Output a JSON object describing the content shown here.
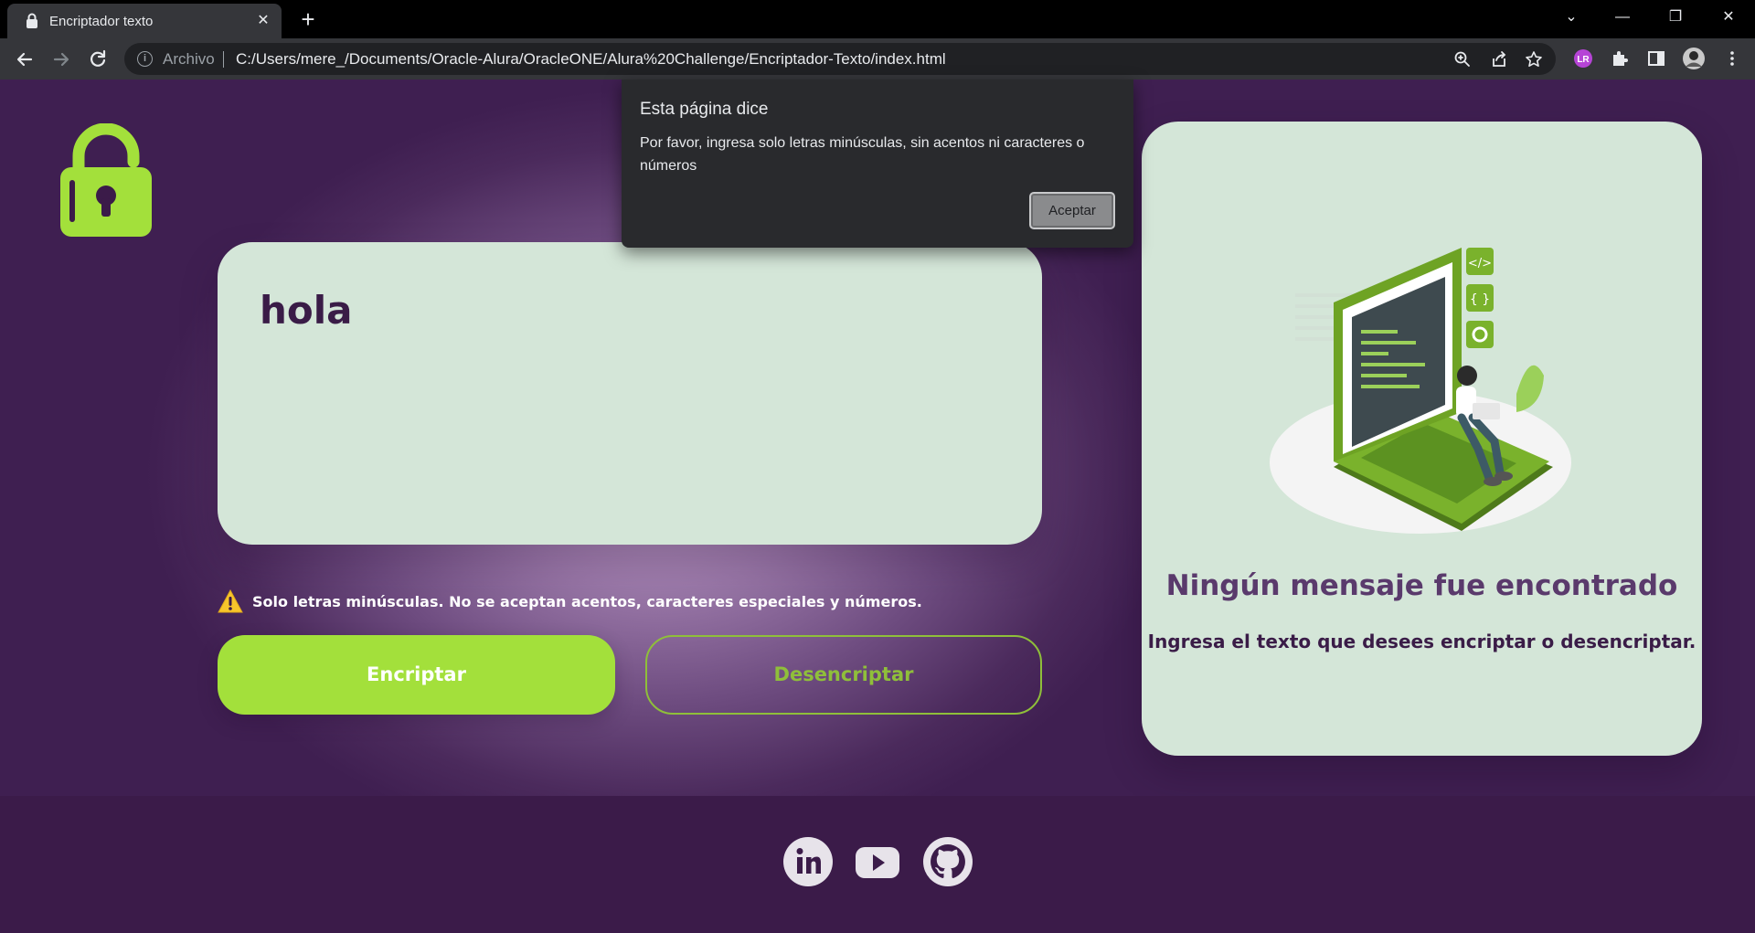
{
  "browser": {
    "tab_title": "Encriptador texto",
    "tab_close": "✕",
    "new_tab": "+",
    "url_scheme": "Archivo",
    "url": "C:/Users/mere_/Documents/Oracle-Alura/OracleONE/Alura%20Challenge/Encriptador-Texto/index.html",
    "window_controls": {
      "dropdown": "⌄",
      "minimize": "—",
      "restore": "❐",
      "close": "✕"
    },
    "profile_initials": "LR",
    "icons": [
      "back-icon",
      "forward-icon",
      "reload-icon",
      "info-icon",
      "zoom-icon",
      "share-icon",
      "star-icon",
      "extension-icon",
      "puzzle-icon",
      "sidepanel-icon",
      "avatar",
      "menu-icon"
    ]
  },
  "dialog": {
    "title": "Esta página dice",
    "message": "Por favor, ingresa solo letras minúsculas, sin acentos ni caracteres o números",
    "ok_label": "Aceptar"
  },
  "main": {
    "input_value": "hola",
    "hint": "Solo letras minúsculas. No se aceptan acentos, caracteres especiales y números.",
    "encrypt_label": "Encriptar",
    "decrypt_label": "Desencriptar"
  },
  "output": {
    "title": "Ningún mensaje fue encontrado",
    "subtitle": "Ingresa el texto que desees encriptar o desencriptar."
  },
  "footer": {
    "icons": [
      "linkedin-icon",
      "youtube-icon",
      "github-icon"
    ]
  },
  "colors": {
    "accent_green": "#a3e03b",
    "card_bg": "#d4e6d8",
    "deep_purple": "#3b1b49",
    "text_purple": "#5a3a6c"
  }
}
